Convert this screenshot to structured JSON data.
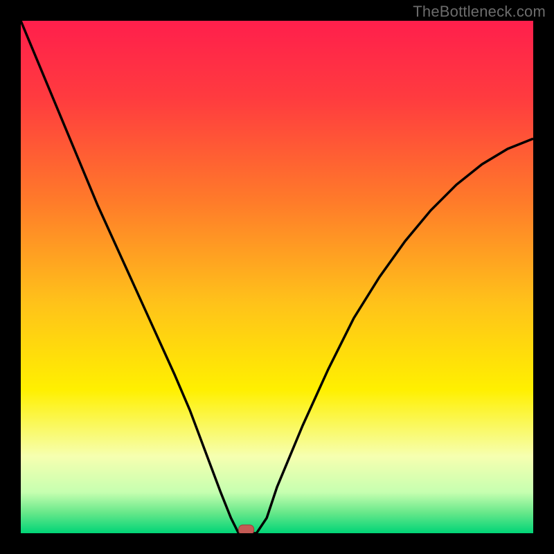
{
  "watermark": "TheBottleneck.com",
  "chart_data": {
    "type": "line",
    "title": "",
    "xlabel": "",
    "ylabel": "",
    "xlim": [
      0,
      100
    ],
    "ylim": [
      0,
      100
    ],
    "x": [
      0,
      5,
      10,
      15,
      20,
      25,
      30,
      33,
      36,
      39,
      41,
      42.5,
      44,
      46,
      48,
      50,
      55,
      60,
      65,
      70,
      75,
      80,
      85,
      90,
      95,
      100
    ],
    "values": [
      100,
      88,
      76,
      64,
      53,
      42,
      31,
      24,
      16,
      8,
      3,
      0,
      0,
      0,
      3,
      9,
      21,
      32,
      42,
      50,
      57,
      63,
      68,
      72,
      75,
      77
    ],
    "notch_x": 44,
    "gradient_stops": [
      {
        "pos": 0.0,
        "color": "#ff1f4c"
      },
      {
        "pos": 0.15,
        "color": "#ff3b3f"
      },
      {
        "pos": 0.35,
        "color": "#ff7a2a"
      },
      {
        "pos": 0.55,
        "color": "#ffc21a"
      },
      {
        "pos": 0.72,
        "color": "#fff000"
      },
      {
        "pos": 0.85,
        "color": "#f6ffb0"
      },
      {
        "pos": 0.92,
        "color": "#c6ffb0"
      },
      {
        "pos": 0.96,
        "color": "#67e88a"
      },
      {
        "pos": 1.0,
        "color": "#00d477"
      }
    ],
    "curve_color": "#000000",
    "marker_fill": "#c45a54",
    "marker_stroke": "#9a3e38"
  }
}
